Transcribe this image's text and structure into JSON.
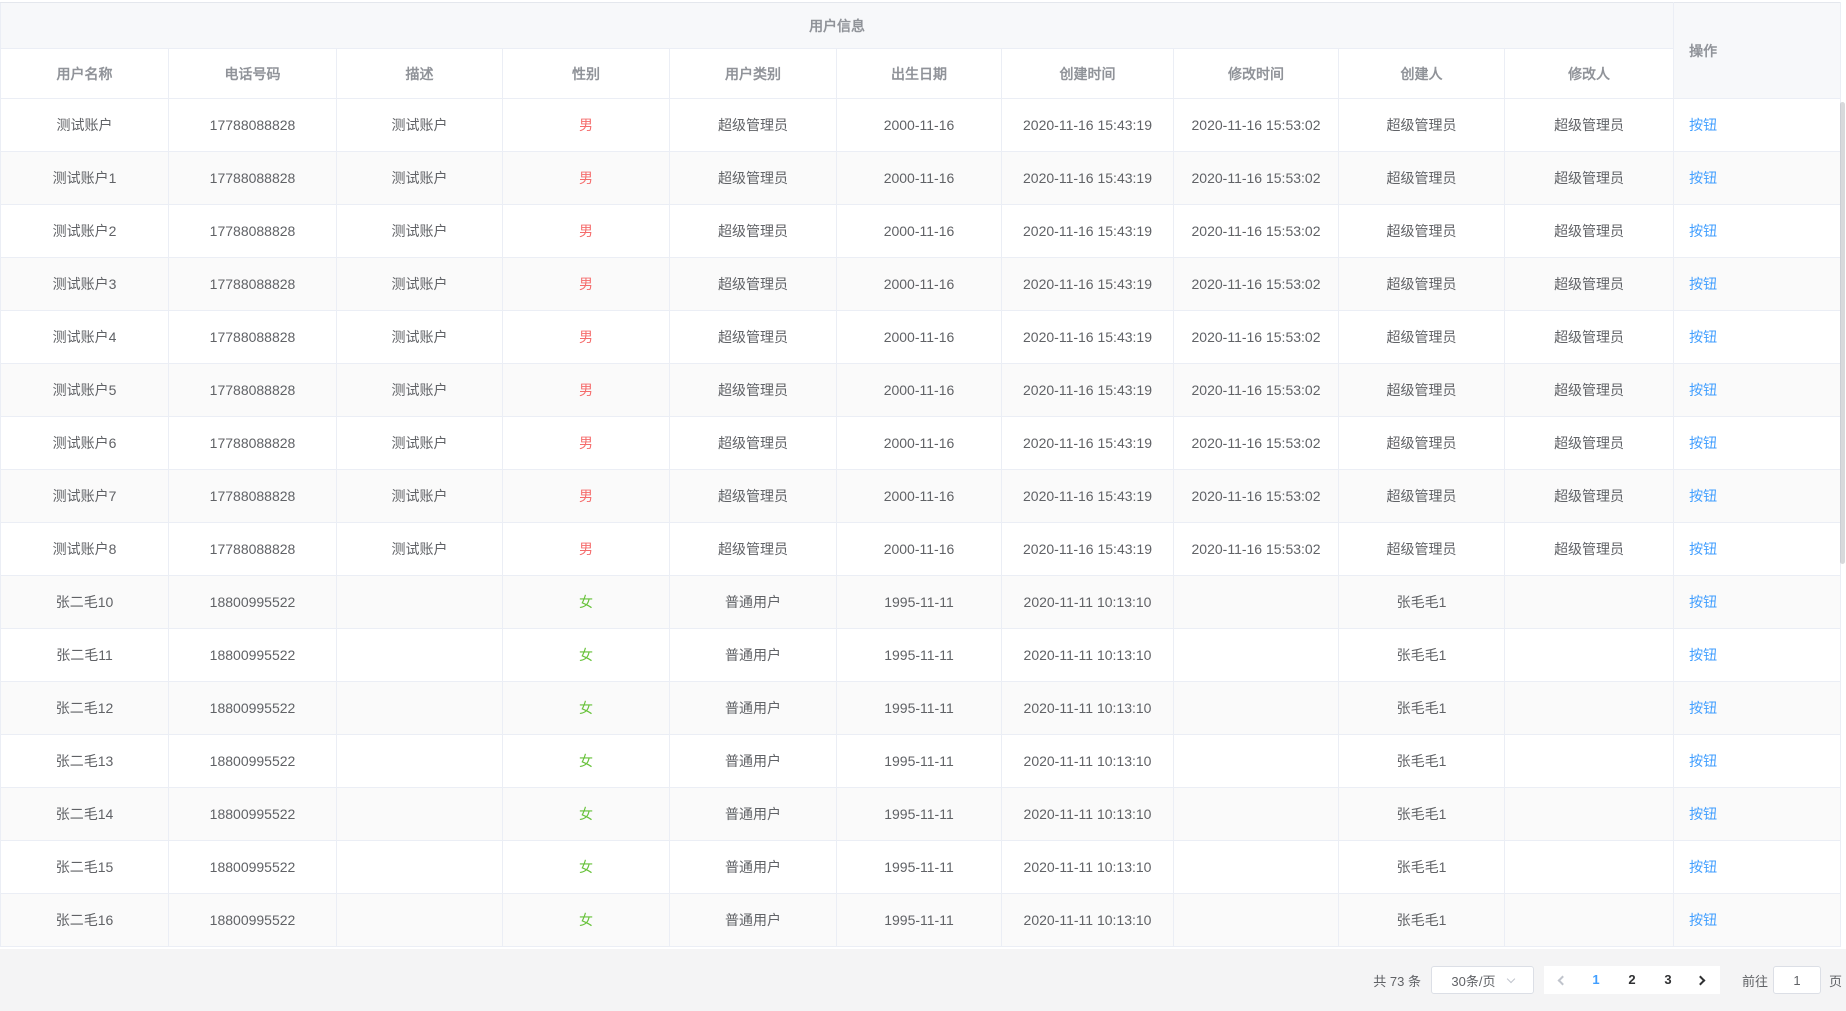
{
  "colors": {
    "male": "#F56C6C",
    "female": "#67C23A",
    "link": "#409EFF"
  },
  "table": {
    "group_header": "用户信息",
    "action_header": "操作",
    "columns": [
      "用户名称",
      "电话号码",
      "描述",
      "性别",
      "用户类别",
      "出生日期",
      "创建时间",
      "修改时间",
      "创建人",
      "修改人"
    ],
    "column_keys": [
      "name",
      "phone",
      "desc",
      "gender",
      "category",
      "birth",
      "created",
      "modified",
      "creator",
      "modifier"
    ],
    "rows": [
      {
        "name": "测试账户",
        "phone": "17788088828",
        "desc": "测试账户",
        "gender": "男",
        "gender_type": "male",
        "category": "超级管理员",
        "birth": "2000-11-16",
        "created": "2020-11-16 15:43:19",
        "modified": "2020-11-16 15:53:02",
        "creator": "超级管理员",
        "modifier": "超级管理员",
        "action": "按钮"
      },
      {
        "name": "测试账户1",
        "phone": "17788088828",
        "desc": "测试账户",
        "gender": "男",
        "gender_type": "male",
        "category": "超级管理员",
        "birth": "2000-11-16",
        "created": "2020-11-16 15:43:19",
        "modified": "2020-11-16 15:53:02",
        "creator": "超级管理员",
        "modifier": "超级管理员",
        "action": "按钮"
      },
      {
        "name": "测试账户2",
        "phone": "17788088828",
        "desc": "测试账户",
        "gender": "男",
        "gender_type": "male",
        "category": "超级管理员",
        "birth": "2000-11-16",
        "created": "2020-11-16 15:43:19",
        "modified": "2020-11-16 15:53:02",
        "creator": "超级管理员",
        "modifier": "超级管理员",
        "action": "按钮"
      },
      {
        "name": "测试账户3",
        "phone": "17788088828",
        "desc": "测试账户",
        "gender": "男",
        "gender_type": "male",
        "category": "超级管理员",
        "birth": "2000-11-16",
        "created": "2020-11-16 15:43:19",
        "modified": "2020-11-16 15:53:02",
        "creator": "超级管理员",
        "modifier": "超级管理员",
        "action": "按钮"
      },
      {
        "name": "测试账户4",
        "phone": "17788088828",
        "desc": "测试账户",
        "gender": "男",
        "gender_type": "male",
        "category": "超级管理员",
        "birth": "2000-11-16",
        "created": "2020-11-16 15:43:19",
        "modified": "2020-11-16 15:53:02",
        "creator": "超级管理员",
        "modifier": "超级管理员",
        "action": "按钮"
      },
      {
        "name": "测试账户5",
        "phone": "17788088828",
        "desc": "测试账户",
        "gender": "男",
        "gender_type": "male",
        "category": "超级管理员",
        "birth": "2000-11-16",
        "created": "2020-11-16 15:43:19",
        "modified": "2020-11-16 15:53:02",
        "creator": "超级管理员",
        "modifier": "超级管理员",
        "action": "按钮"
      },
      {
        "name": "测试账户6",
        "phone": "17788088828",
        "desc": "测试账户",
        "gender": "男",
        "gender_type": "male",
        "category": "超级管理员",
        "birth": "2000-11-16",
        "created": "2020-11-16 15:43:19",
        "modified": "2020-11-16 15:53:02",
        "creator": "超级管理员",
        "modifier": "超级管理员",
        "action": "按钮"
      },
      {
        "name": "测试账户7",
        "phone": "17788088828",
        "desc": "测试账户",
        "gender": "男",
        "gender_type": "male",
        "category": "超级管理员",
        "birth": "2000-11-16",
        "created": "2020-11-16 15:43:19",
        "modified": "2020-11-16 15:53:02",
        "creator": "超级管理员",
        "modifier": "超级管理员",
        "action": "按钮"
      },
      {
        "name": "测试账户8",
        "phone": "17788088828",
        "desc": "测试账户",
        "gender": "男",
        "gender_type": "male",
        "category": "超级管理员",
        "birth": "2000-11-16",
        "created": "2020-11-16 15:43:19",
        "modified": "2020-11-16 15:53:02",
        "creator": "超级管理员",
        "modifier": "超级管理员",
        "action": "按钮"
      },
      {
        "name": "张二毛10",
        "phone": "18800995522",
        "desc": "",
        "gender": "女",
        "gender_type": "female",
        "category": "普通用户",
        "birth": "1995-11-11",
        "created": "2020-11-11 10:13:10",
        "modified": "",
        "creator": "张毛毛1",
        "modifier": "",
        "action": "按钮"
      },
      {
        "name": "张二毛11",
        "phone": "18800995522",
        "desc": "",
        "gender": "女",
        "gender_type": "female",
        "category": "普通用户",
        "birth": "1995-11-11",
        "created": "2020-11-11 10:13:10",
        "modified": "",
        "creator": "张毛毛1",
        "modifier": "",
        "action": "按钮"
      },
      {
        "name": "张二毛12",
        "phone": "18800995522",
        "desc": "",
        "gender": "女",
        "gender_type": "female",
        "category": "普通用户",
        "birth": "1995-11-11",
        "created": "2020-11-11 10:13:10",
        "modified": "",
        "creator": "张毛毛1",
        "modifier": "",
        "action": "按钮"
      },
      {
        "name": "张二毛13",
        "phone": "18800995522",
        "desc": "",
        "gender": "女",
        "gender_type": "female",
        "category": "普通用户",
        "birth": "1995-11-11",
        "created": "2020-11-11 10:13:10",
        "modified": "",
        "creator": "张毛毛1",
        "modifier": "",
        "action": "按钮"
      },
      {
        "name": "张二毛14",
        "phone": "18800995522",
        "desc": "",
        "gender": "女",
        "gender_type": "female",
        "category": "普通用户",
        "birth": "1995-11-11",
        "created": "2020-11-11 10:13:10",
        "modified": "",
        "creator": "张毛毛1",
        "modifier": "",
        "action": "按钮"
      },
      {
        "name": "张二毛15",
        "phone": "18800995522",
        "desc": "",
        "gender": "女",
        "gender_type": "female",
        "category": "普通用户",
        "birth": "1995-11-11",
        "created": "2020-11-11 10:13:10",
        "modified": "",
        "creator": "张毛毛1",
        "modifier": "",
        "action": "按钮"
      },
      {
        "name": "张二毛16",
        "phone": "18800995522",
        "desc": "",
        "gender": "女",
        "gender_type": "female",
        "category": "普通用户",
        "birth": "1995-11-11",
        "created": "2020-11-11 10:13:10",
        "modified": "",
        "creator": "张毛毛1",
        "modifier": "",
        "action": "按钮"
      }
    ]
  },
  "pagination": {
    "total": "共 73 条",
    "page_size": "30条/页",
    "pages": [
      "1",
      "2",
      "3"
    ],
    "active_page": "1",
    "jump_prefix": "前往",
    "jump_value": "1",
    "jump_suffix": "页"
  }
}
